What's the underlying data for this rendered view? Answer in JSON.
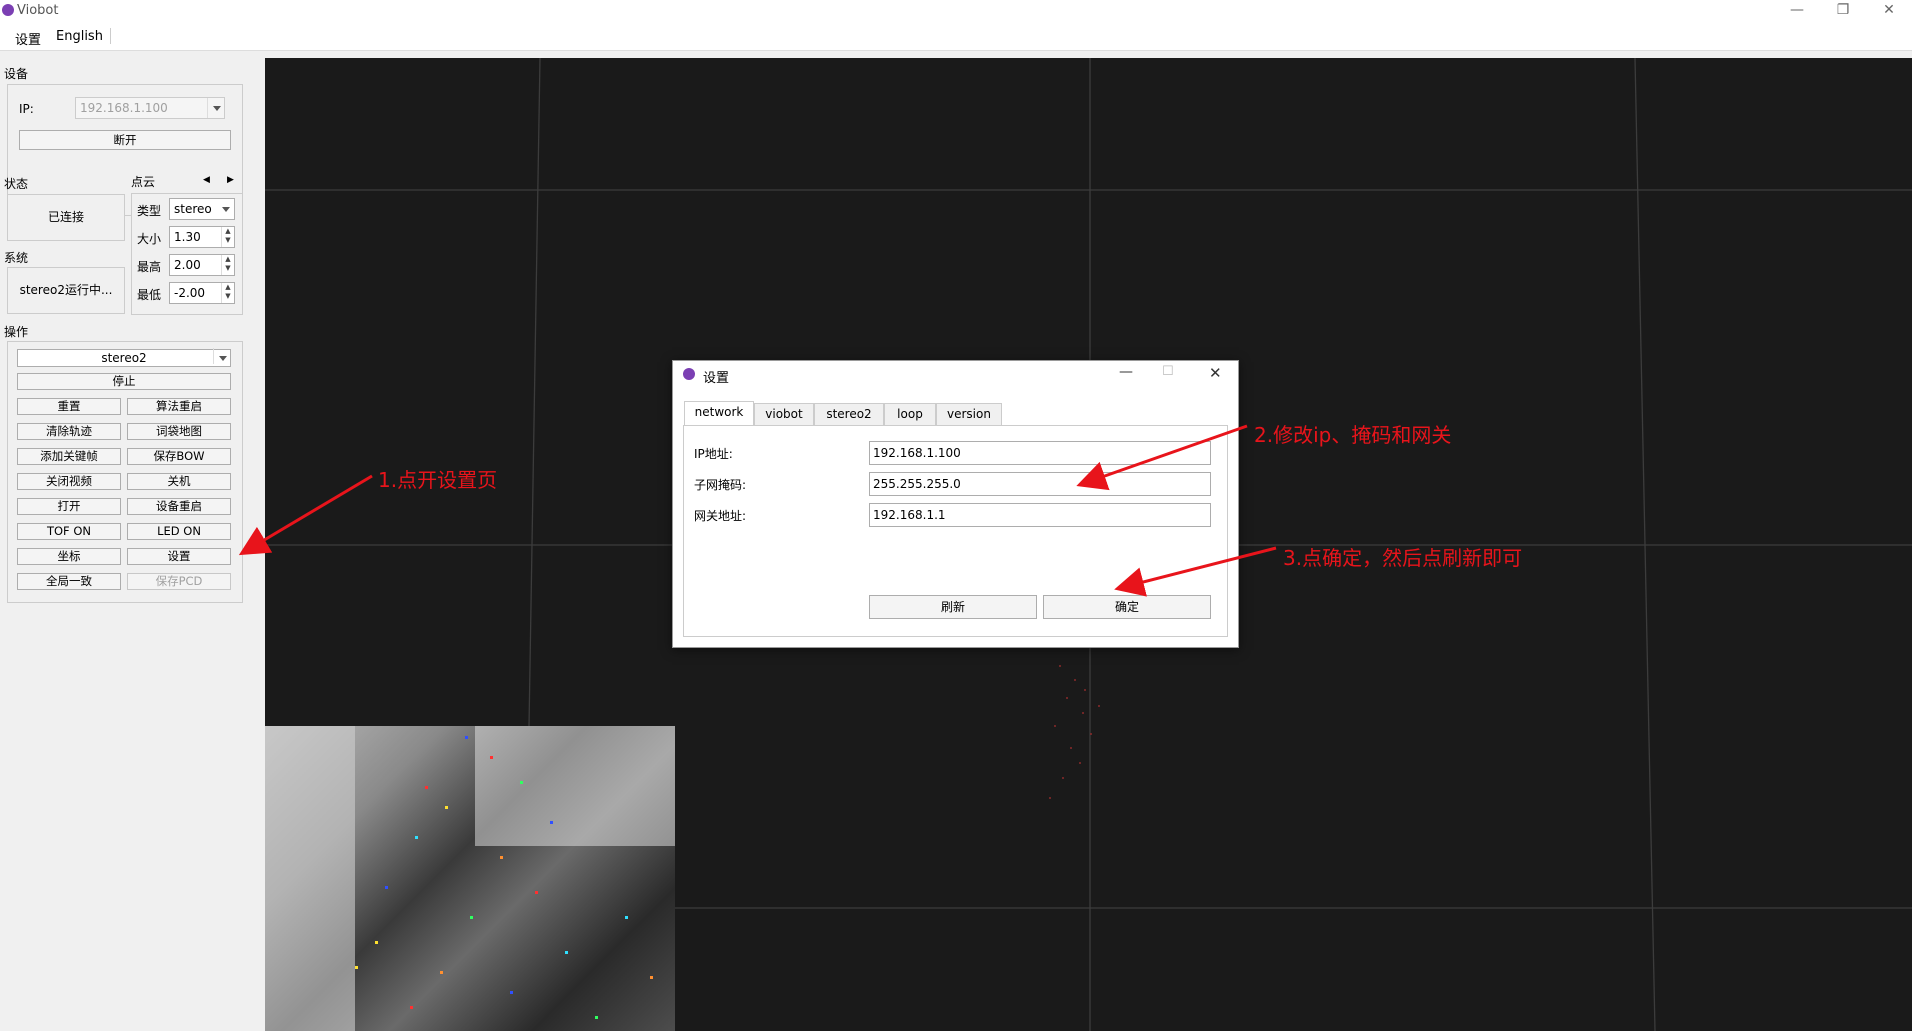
{
  "window": {
    "title": "Viobot",
    "minimize": "—",
    "restore": "❐",
    "close": "✕"
  },
  "menu": {
    "items": [
      "设置",
      "English"
    ]
  },
  "device": {
    "section_label": "设备",
    "ip_label": "IP:",
    "ip_value": "192.168.1.100",
    "disconnect_label": "断开"
  },
  "status": {
    "section_label": "状态",
    "value": "已连接"
  },
  "system": {
    "section_label": "系统",
    "value": "stereo2运行中..."
  },
  "pointcloud": {
    "section_label": "点云",
    "nav_prev": "◀",
    "nav_next": "▶",
    "type_label": "类型",
    "type_value": "stereo",
    "size_label": "大小",
    "size_value": "1.30",
    "max_label": "最高",
    "max_value": "2.00",
    "min_label": "最低",
    "min_value": "-2.00"
  },
  "operation": {
    "section_label": "操作",
    "mode_value": "stereo2",
    "stop_label": "停止",
    "buttons": [
      {
        "left": "重置",
        "right": "算法重启"
      },
      {
        "left": "清除轨迹",
        "right": "词袋地图"
      },
      {
        "left": "添加关键帧",
        "right": "保存BOW"
      },
      {
        "left": "关闭视频",
        "right": "关机"
      },
      {
        "left": "打开",
        "right": "设备重启"
      },
      {
        "left": "TOF ON",
        "right": "LED ON"
      },
      {
        "left": "坐标",
        "right": "设置"
      },
      {
        "left": "全局一致",
        "right": "保存PCD"
      }
    ]
  },
  "dialog": {
    "title": "设置",
    "tabs": [
      "network",
      "viobot",
      "stereo2",
      "loop",
      "version"
    ],
    "active_tab": "network",
    "ip_label": "IP地址:",
    "ip_value": "192.168.1.100",
    "mask_label": "子网掩码:",
    "mask_value": "255.255.255.0",
    "gateway_label": "网关地址:",
    "gateway_value": "192.168.1.1",
    "refresh_label": "刷新",
    "ok_label": "确定"
  },
  "annotations": {
    "step1": "1.点开设置页",
    "step2": "2.修改ip、掩码和网关",
    "step3": "3.点确定，然后点刷新即可"
  },
  "colors": {
    "annotation": "#e8141b",
    "viewport": "#1a1a1a",
    "brand": "#7b3fb3"
  }
}
